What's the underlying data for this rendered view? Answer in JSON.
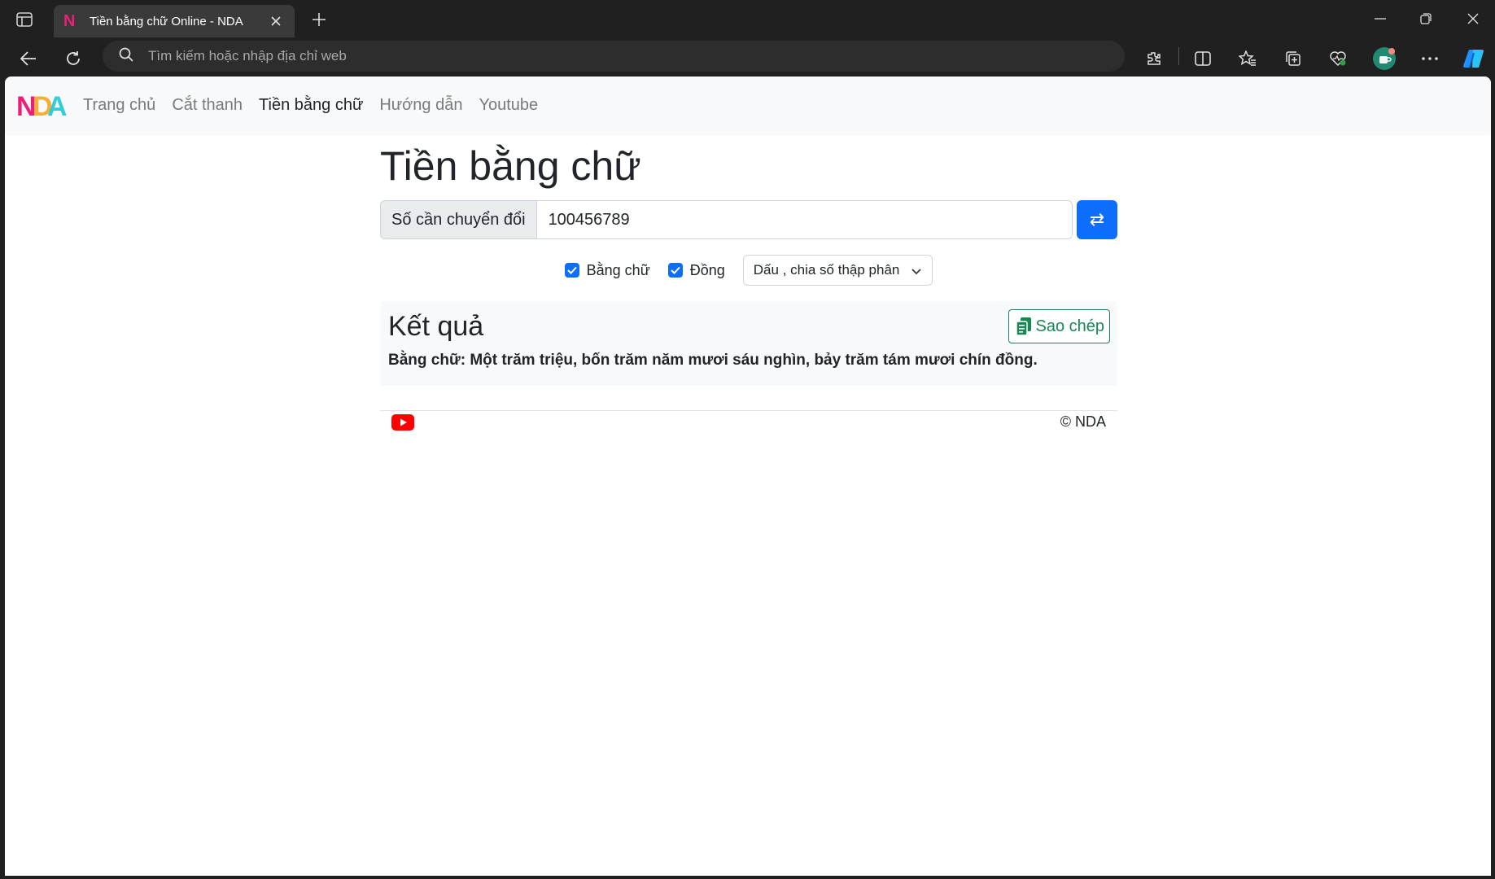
{
  "browser": {
    "tab_title": "Tiền bằng chữ Online - NDA",
    "favicon_letter": "N",
    "address_placeholder": "Tìm kiếm hoặc nhập địa chỉ web"
  },
  "navbar": {
    "brand": "NDA",
    "links": [
      "Trang chủ",
      "Cắt thanh",
      "Tiền bằng chữ",
      "Hướng dẫn",
      "Youtube"
    ],
    "active_index": 2
  },
  "main": {
    "title": "Tiền bằng chữ",
    "input_label": "Số cần chuyển đổi",
    "input_value": "100456789",
    "convert_icon": "⇄",
    "options": {
      "check_words": "Bằng chữ",
      "check_dong": "Đồng",
      "separator_select": "Dấu , chia số thập phân"
    }
  },
  "result": {
    "title": "Kết quả",
    "copy_label": "Sao chép",
    "text": "Bằng chữ: Một trăm triệu, bốn trăm năm mươi sáu nghìn, bảy trăm tám mươi chín đồng."
  },
  "footer": {
    "copyright": "© NDA"
  },
  "colors": {
    "primary": "#0d6efd",
    "success": "#198754",
    "youtube": "#ff0000",
    "brand_pink": "#e9207a",
    "brand_cyan": "#1ec9d6"
  }
}
